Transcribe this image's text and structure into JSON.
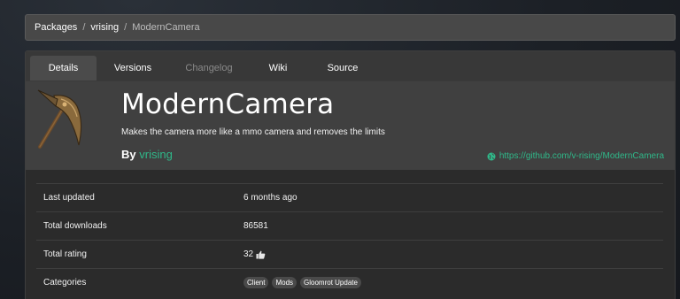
{
  "breadcrumb": {
    "items": [
      "Packages",
      "vrising"
    ],
    "separator": "/",
    "current": "ModernCamera"
  },
  "tabs": [
    {
      "label": "Details",
      "state": "active"
    },
    {
      "label": "Versions",
      "state": "normal"
    },
    {
      "label": "Changelog",
      "state": "disabled"
    },
    {
      "label": "Wiki",
      "state": "normal"
    },
    {
      "label": "Source",
      "state": "normal"
    }
  ],
  "package": {
    "name": "ModernCamera",
    "description": "Makes the camera more like a mmo camera and removes the limits",
    "by_label": "By",
    "author": "vrising",
    "website": "https://github.com/v-rising/ModernCamera",
    "icon": "pickaxe-icon"
  },
  "info": {
    "last_updated_label": "Last updated",
    "last_updated": "6 months ago",
    "downloads_label": "Total downloads",
    "downloads": "86581",
    "rating_label": "Total rating",
    "rating": "32",
    "categories_label": "Categories",
    "categories": [
      "Client",
      "Mods",
      "Gloomrot Update"
    ]
  },
  "colors": {
    "accent": "#2fb889",
    "panel": "#404040",
    "card": "#2b2b2b"
  }
}
